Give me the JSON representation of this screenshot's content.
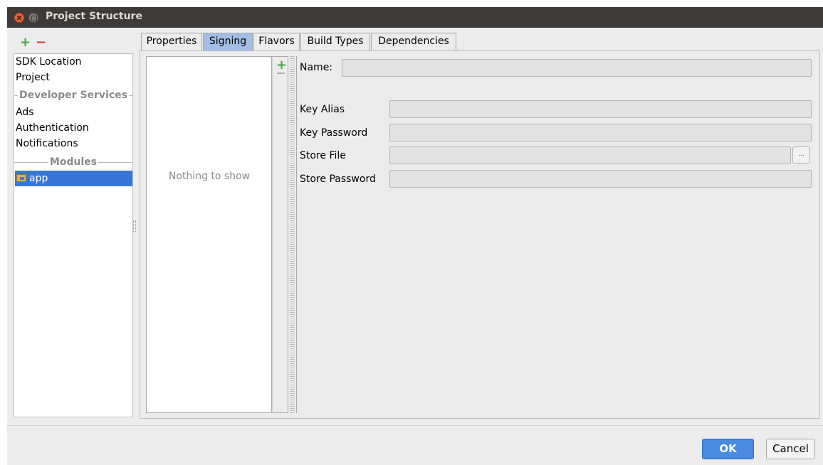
{
  "window": {
    "title": "Project Structure"
  },
  "left_toolbar": {
    "add": "+",
    "remove": "−"
  },
  "sidebar": {
    "items": [
      {
        "label": "SDK Location"
      },
      {
        "label": "Project"
      }
    ],
    "section_developer_services": "Developer Services",
    "services": [
      {
        "label": "Ads"
      },
      {
        "label": "Authentication"
      },
      {
        "label": "Notifications"
      }
    ],
    "section_modules": "Modules",
    "modules": [
      {
        "label": "app",
        "selected": true
      }
    ]
  },
  "tabs": [
    {
      "label": "Properties",
      "active": false
    },
    {
      "label": "Signing",
      "active": true
    },
    {
      "label": "Flavors",
      "active": false
    },
    {
      "label": "Build Types",
      "active": false
    },
    {
      "label": "Dependencies",
      "active": false
    }
  ],
  "signing": {
    "empty_list_text": "Nothing to show",
    "list_add": "+",
    "fields": {
      "name": {
        "label": "Name:",
        "value": ""
      },
      "key_alias": {
        "label": "Key Alias",
        "value": ""
      },
      "key_password": {
        "label": "Key Password",
        "value": ""
      },
      "store_file": {
        "label": "Store File",
        "value": "",
        "browse": "..."
      },
      "store_password": {
        "label": "Store Password",
        "value": ""
      }
    }
  },
  "buttons": {
    "ok": "OK",
    "cancel": "Cancel"
  },
  "colors": {
    "selection": "#3875d7",
    "ok_button": "#4a8ae0",
    "active_tab": "#a3bde6",
    "titlebar": "#3c3b37"
  }
}
